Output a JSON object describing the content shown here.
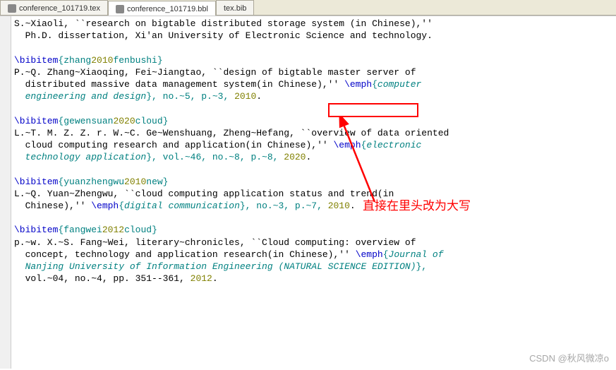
{
  "tabs": {
    "t0": "conference_101719.tex",
    "t1": "conference_101719.bbl",
    "t2": "tex.bib"
  },
  "code": {
    "l1a": "S.~Xiaoli, ``research on bigtable distributed storage system (in Chinese),''",
    "l1b": "  Ph.D. dissertation, Xi'an University of Electronic Science and technology.",
    "l2": "",
    "l3_cmd": "\\bibitem",
    "l3_arg_a": "{zhang",
    "l3_arg_n": "2010",
    "l3_arg_b": "fenbushi}",
    "l4": "P.~Q. Zhang~Xiaoqing, Fei~Jiangtao, ``design of bigtable master server of",
    "l5a": "  distributed massive data management system(in Chinese),'' ",
    "l5_emph": "\\emph",
    "l5b": "{",
    "l5_it": "computer",
    "l6_it": "  engineering and design",
    "l6b": "}, no.~5, p.~3, ",
    "l6n": "2010",
    "l6c": ".",
    "l7": "",
    "l8_cmd": "\\bibitem",
    "l8_arg_a": "{gewensuan",
    "l8_arg_n": "2020",
    "l8_arg_b": "cloud}",
    "l9": "L.~T. M. Z. Z. r. W.~C. Ge~Wenshuang, Zheng~Hefang, ``overview of data oriented",
    "l10a": "  cloud computing research and application(in Chinese),'' ",
    "l10_emph": "\\emph",
    "l10b": "{",
    "l10_it": "electronic",
    "l11_it": "  technology application",
    "l11b": "}, vol.~46, no.~8, p.~8, ",
    "l11n": "2020",
    "l11c": ".",
    "l12": "",
    "l13_cmd": "\\bibitem",
    "l13_arg_a": "{yuanzhengwu",
    "l13_arg_n": "2010",
    "l13_arg_b": "new}",
    "l14": "L.~Q. Yuan~Zhengwu, ``cloud computing application status and trend(in",
    "l15a": "  Chinese),'' ",
    "l15_emph": "\\emph",
    "l15b": "{",
    "l15_it": "digital communication",
    "l15c": "}, no.~3, p.~7, ",
    "l15n": "2010",
    "l15d": ".",
    "l16": "",
    "l17_cmd": "\\bibitem",
    "l17_arg_a": "{fangwei",
    "l17_arg_n": "2012",
    "l17_arg_b": "cloud}",
    "l18": "p.~w. X.~S. Fang~Wei, literary~chronicles, ``Cloud computing: overview of",
    "l19a": "  concept, technology and application research(in Chinese),'' ",
    "l19_emph": "\\emph",
    "l19b": "{",
    "l19_it": "Journal of",
    "l20_it": "  Nanjing University of Information Engineering (NATURAL SCIENCE EDITION)",
    "l20b": "},",
    "l21a": "  vol.~04, no.~4, pp. 351--361, ",
    "l21n": "2012",
    "l21b": "."
  },
  "annotation": {
    "text": "直接在里头改为大写"
  },
  "watermark": "CSDN @秋风微凉o"
}
